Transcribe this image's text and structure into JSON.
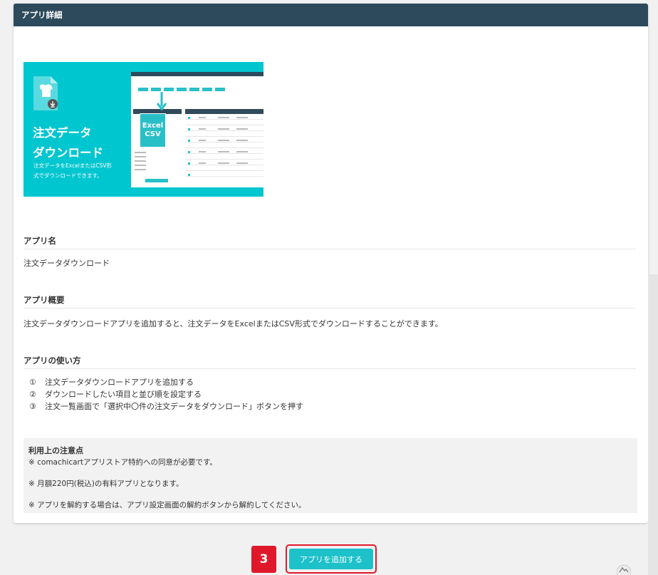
{
  "header": {
    "title": "アプリ詳細"
  },
  "banner": {
    "title": "注文データ\nダウンロード",
    "description": "注文データをExcelまたはCSV形\n式でダウンロードできます。",
    "badge_text": "Excel\nCSV",
    "icon": "document-shirt-download-icon",
    "accent_color": "#00c6d0"
  },
  "app_name": {
    "heading": "アプリ名",
    "value": "注文データダウンロード"
  },
  "app_overview": {
    "heading": "アプリ概要",
    "value": "注文データダウンロードアプリを追加すると、注文データをExcelまたはCSV形式でダウンロードすることができます。"
  },
  "app_usage": {
    "heading": "アプリの使い方",
    "steps": [
      {
        "num": "①",
        "text": "注文データダウンロードアプリを追加する"
      },
      {
        "num": "②",
        "text": "ダウンロードしたい項目と並び順を設定する"
      },
      {
        "num": "③",
        "text": "注文一覧画面で「選択中〇件の注文データをダウンロード」ボタンを押す"
      }
    ]
  },
  "notes": {
    "heading": "利用上の注意点",
    "items": [
      "※ comachicartアプリストア特約への同意が必要です。",
      "※ 月額220円(税込)の有料アプリとなります。",
      "※ アプリを解約する場合は、アプリ設定画面の解約ボタンから解約してください。"
    ]
  },
  "step_badge": "3",
  "add_button": {
    "label": "アプリを追加する",
    "color": "#1cc1c9"
  },
  "colors": {
    "header": "#2c4a5c",
    "highlight": "#e0192a"
  }
}
